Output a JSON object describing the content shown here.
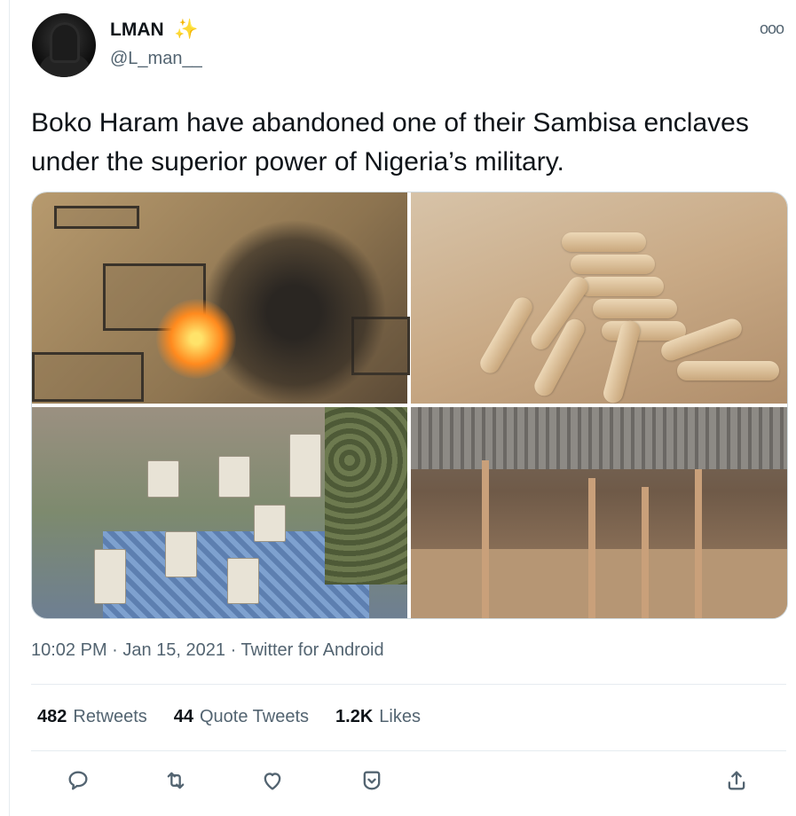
{
  "author": {
    "name": "LMAN",
    "name_emoji": "✨",
    "handle": "@L_man__"
  },
  "tweet": {
    "text": "Boko Haram have abandoned one of their Sambisa enclaves under the superior power of Nigeria’s military.",
    "timestamp": "10:02 PM · Jan 15, 2021 · Twitter for Android"
  },
  "stats": {
    "retweets_count": "482",
    "retweets_label": "Retweets",
    "quotes_count": "44",
    "quotes_label": "Quote Tweets",
    "likes_count": "1.2K",
    "likes_label": "Likes"
  },
  "colors": {
    "text_primary": "#0f1419",
    "text_secondary": "#536471",
    "divider": "#e6ecf0"
  },
  "icons": [
    "more-icon",
    "reply-icon",
    "retweet-icon",
    "like-icon",
    "bookmark-icon",
    "share-icon"
  ]
}
